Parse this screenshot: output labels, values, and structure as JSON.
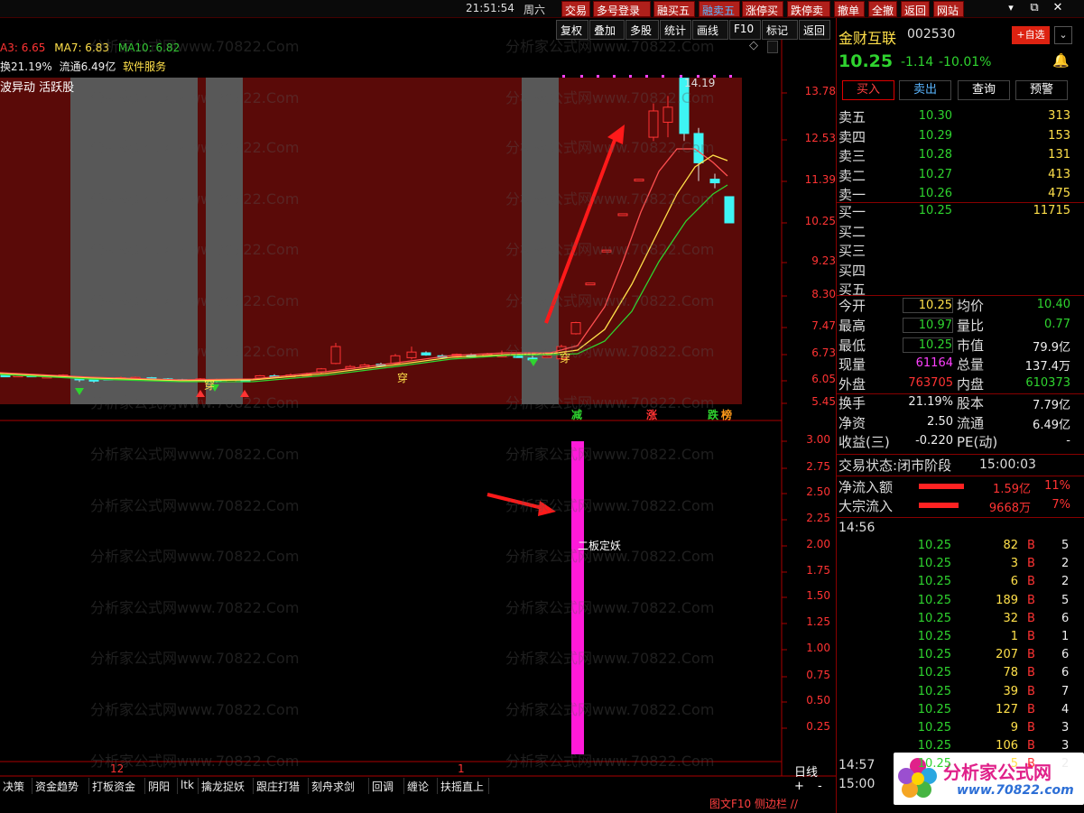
{
  "topbar": {
    "time": "21:51:54",
    "weekday": "周六",
    "buttons": [
      "交易",
      "多号登录",
      "融买五",
      "融卖五",
      "涨停买",
      "跌停卖",
      "撤单",
      "全撤",
      "返回",
      "网站"
    ],
    "window_controls": [
      "▾",
      "⧉",
      "✕"
    ]
  },
  "toolbar": [
    "复权",
    "叠加",
    "多股",
    "统计",
    "画线",
    "F10",
    "标记",
    "返回"
  ],
  "indicator_line": {
    "ma5_label": "A3: 6.65",
    "ma7_label": "MA7: 6.83",
    "ma10_label": "MA10: 6.82"
  },
  "info_line": {
    "turnover_text": "换21.19%",
    "float_text": "流通6.49亿",
    "service_text": "软件服务"
  },
  "tag_line": "波异动 活跃股",
  "max_label": "14.19",
  "price_axis": [
    "13.78",
    "12.53",
    "11.39",
    "10.25",
    "9.23",
    "8.30",
    "7.47",
    "6.73",
    "6.05",
    "5.45"
  ],
  "indicator_axis": [
    "3.00",
    "2.75",
    "2.50",
    "2.25",
    "2.00",
    "1.75",
    "1.50",
    "1.25",
    "1.00",
    "0.75",
    "0.50",
    "0.25"
  ],
  "signals": {
    "jian": "减",
    "zhang": "涨",
    "die": "跌",
    "bang": "榜",
    "chuan": "穿"
  },
  "indicator_note": "二板定妖",
  "date_labels": {
    "d12": "12",
    "d1": "1"
  },
  "period": "日线",
  "zoom": {
    "plus": "+",
    "minus": "-"
  },
  "bottom_tabs": [
    "决策",
    "资金趋势",
    "打板资金",
    "阴阳",
    "ltk",
    "擒龙捉妖",
    "跟庄打猎",
    "刻舟求剑",
    "回调",
    "缠论",
    "扶摇直上"
  ],
  "bottom_right_text": "图文F10 侧边栏 //",
  "stock": {
    "name": "金财互联",
    "code": "002530",
    "add_label": "+自选",
    "price": "10.25",
    "change": "-1.14",
    "change_pct": "-10.01%",
    "buttons": [
      "买入",
      "卖出",
      "查询",
      "预警"
    ]
  },
  "order_book": {
    "asks": [
      {
        "label": "卖五",
        "price": "10.30",
        "vol": "313"
      },
      {
        "label": "卖四",
        "price": "10.29",
        "vol": "153"
      },
      {
        "label": "卖三",
        "price": "10.28",
        "vol": "131"
      },
      {
        "label": "卖二",
        "price": "10.27",
        "vol": "413"
      },
      {
        "label": "卖一",
        "price": "10.26",
        "vol": "475"
      }
    ],
    "bids": [
      {
        "label": "买一",
        "price": "10.25",
        "vol": "11715"
      },
      {
        "label": "买二",
        "price": "",
        "vol": ""
      },
      {
        "label": "买三",
        "price": "",
        "vol": ""
      },
      {
        "label": "买四",
        "price": "",
        "vol": ""
      },
      {
        "label": "买五",
        "price": "",
        "vol": ""
      }
    ]
  },
  "stats": [
    {
      "l1": "今开",
      "v1": "10.25",
      "l2": "均价",
      "v2": "10.40"
    },
    {
      "l1": "最高",
      "v1": "10.97",
      "l2": "量比",
      "v2": "0.77"
    },
    {
      "l1": "最低",
      "v1": "10.25",
      "l2": "市值",
      "v2": "79.9亿"
    },
    {
      "l1": "现量",
      "v1": "61164",
      "l2": "总量",
      "v2": "137.4万"
    },
    {
      "l1": "外盘",
      "v1": "763705",
      "l2": "内盘",
      "v2": "610373"
    }
  ],
  "stats2": [
    {
      "l1": "换手",
      "v1": "21.19%",
      "l2": "股本",
      "v2": "7.79亿"
    },
    {
      "l1": "净资",
      "v1": "2.50",
      "l2": "流通",
      "v2": "6.49亿"
    },
    {
      "l1": "收益(三)",
      "v1": "-0.220",
      "l2": "PE(动)",
      "v2": "-"
    }
  ],
  "trade_status": {
    "label": "交易状态:",
    "value": "闭市阶段",
    "time": "15:00:03"
  },
  "flows": [
    {
      "label": "净流入额",
      "amount": "1.59亿",
      "pct": "11%"
    },
    {
      "label": "大宗流入",
      "amount": "9668万",
      "pct": "7%"
    }
  ],
  "ticks_time": "14:56",
  "ticks": [
    {
      "p": "10.25",
      "v": "82",
      "s": "B",
      "n": "5"
    },
    {
      "p": "10.25",
      "v": "3",
      "s": "B",
      "n": "2"
    },
    {
      "p": "10.25",
      "v": "6",
      "s": "B",
      "n": "2"
    },
    {
      "p": "10.25",
      "v": "189",
      "s": "B",
      "n": "5"
    },
    {
      "p": "10.25",
      "v": "32",
      "s": "B",
      "n": "6"
    },
    {
      "p": "10.25",
      "v": "1",
      "s": "B",
      "n": "1"
    },
    {
      "p": "10.25",
      "v": "207",
      "s": "B",
      "n": "6"
    },
    {
      "p": "10.25",
      "v": "78",
      "s": "B",
      "n": "6"
    },
    {
      "p": "10.25",
      "v": "39",
      "s": "B",
      "n": "7"
    },
    {
      "p": "10.25",
      "v": "127",
      "s": "B",
      "n": "4"
    },
    {
      "p": "10.25",
      "v": "9",
      "s": "B",
      "n": "3"
    },
    {
      "p": "10.25",
      "v": "106",
      "s": "B",
      "n": "3"
    },
    {
      "p": "10.25",
      "v": "5",
      "s": "B",
      "n": "2"
    }
  ],
  "ticks_time2": "14:57",
  "ticks_time3": "15:00",
  "logo": {
    "title": "分析家公式网",
    "url": "www.70822.com"
  },
  "watermark": "分析家公式网www.70822.Com",
  "colors": {
    "accent": "#ff0000",
    "bg": "#000000",
    "up": "#ff3333",
    "down": "#2fd42f",
    "panel_bg": "#5a0a08",
    "shade": "#555555",
    "indicator": "#ff1ad9"
  }
}
